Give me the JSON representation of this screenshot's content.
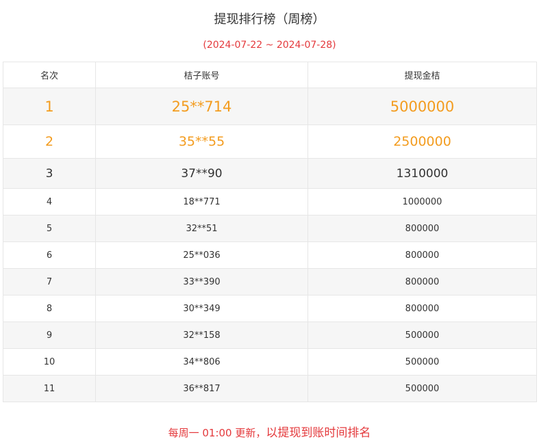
{
  "header": {
    "title": "提现排行榜（周榜）",
    "date_range": "(2024-07-22 ~ 2024-07-28)"
  },
  "table": {
    "columns": [
      "名次",
      "桔子账号",
      "提现金桔"
    ],
    "rows": [
      {
        "rank": "1",
        "account": "25**714",
        "amount": "5000000"
      },
      {
        "rank": "2",
        "account": "35**55",
        "amount": "2500000"
      },
      {
        "rank": "3",
        "account": "37**90",
        "amount": "1310000"
      },
      {
        "rank": "4",
        "account": "18**771",
        "amount": "1000000"
      },
      {
        "rank": "5",
        "account": "32**51",
        "amount": "800000"
      },
      {
        "rank": "6",
        "account": "25**036",
        "amount": "800000"
      },
      {
        "rank": "7",
        "account": "33**390",
        "amount": "800000"
      },
      {
        "rank": "8",
        "account": "30**349",
        "amount": "800000"
      },
      {
        "rank": "9",
        "account": "32**158",
        "amount": "500000"
      },
      {
        "rank": "10",
        "account": "34**806",
        "amount": "500000"
      },
      {
        "rank": "11",
        "account": "36**817",
        "amount": "500000"
      }
    ]
  },
  "footer": {
    "schedule": "每周一 01:00 更新，",
    "rule": "以提现到账时间排名"
  },
  "colors": {
    "top_rank": "#f39c1f",
    "accent_red": "#e4393c",
    "text": "#333333",
    "stripe": "#f6f6f6",
    "border": "#e6e6e6"
  }
}
